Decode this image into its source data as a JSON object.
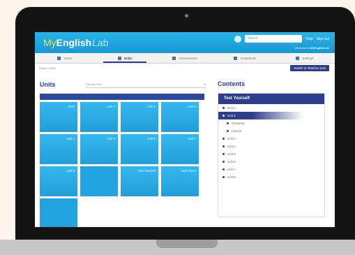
{
  "header": {
    "logo_my": "My",
    "logo_english": "English",
    "logo_lab": "Lab",
    "search_placeholder": "Search",
    "links": [
      "Help",
      "Sign out"
    ],
    "subline_prefix": "Welcome to ",
    "subline_bold": "MyEnglishLab"
  },
  "nav": {
    "items": [
      {
        "label": "Home",
        "active": false
      },
      {
        "label": "Units",
        "active": true
      },
      {
        "label": "Assessments",
        "active": false
      },
      {
        "label": "Gradebook",
        "active": false
      },
      {
        "label": "Settings",
        "active": false
      }
    ]
  },
  "breadcrumb": "Home › Units",
  "report_button": "Switch to Teacher view",
  "units": {
    "title": "Units",
    "select_value": "Choose Unit...",
    "tiles": [
      "Intro",
      "Unit 1",
      "Unit 2",
      "Unit 3",
      "Unit 4",
      "Unit 5",
      "Unit 6",
      "Unit 7",
      "Unit 8",
      "",
      "Test Yourself",
      "Self-check",
      ""
    ]
  },
  "contents": {
    "title": "Contents",
    "header": "Test Yourself",
    "items": [
      {
        "label": "Unit 1",
        "active": false,
        "sub": false
      },
      {
        "label": "Unit 2",
        "active": true,
        "sub": false
      },
      {
        "label": "Grammar",
        "active": false,
        "sub": true
      },
      {
        "label": "Lexical",
        "active": false,
        "sub": true
      },
      {
        "label": "Unit 3",
        "active": false,
        "sub": false
      },
      {
        "label": "Unit 4",
        "active": false,
        "sub": false
      },
      {
        "label": "Unit 5",
        "active": false,
        "sub": false
      },
      {
        "label": "Unit 6",
        "active": false,
        "sub": false
      },
      {
        "label": "Unit 7",
        "active": false,
        "sub": false
      },
      {
        "label": "Unit 8",
        "active": false,
        "sub": false
      }
    ]
  },
  "colors": {
    "brand": "#1f9fd9",
    "accent": "#2c3e8c"
  }
}
